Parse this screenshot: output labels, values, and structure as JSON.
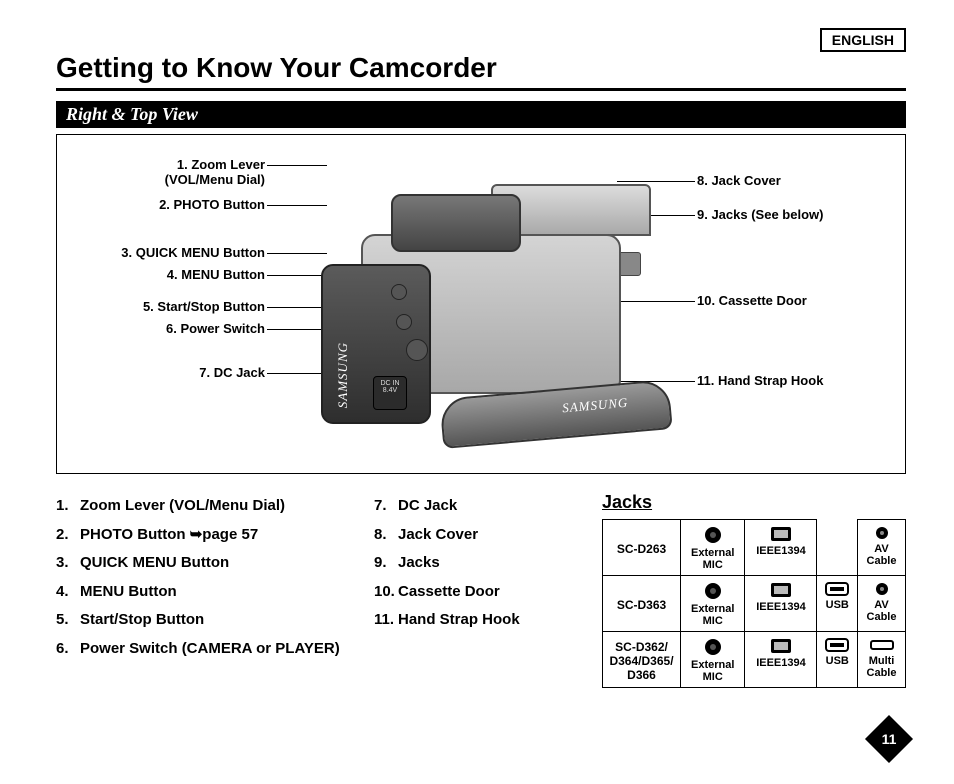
{
  "language_badge": "ENGLISH",
  "title": "Getting to Know Your Camcorder",
  "section": "Right & Top View",
  "brand": "SAMSUNG",
  "dc_label": "DC IN\n8.4V",
  "callouts_left": [
    {
      "n": "1",
      "label": "1. Zoom Lever",
      "sub": "(VOL/Menu Dial)"
    },
    {
      "n": "2",
      "label": "2. PHOTO Button"
    },
    {
      "n": "3",
      "label": "3. QUICK MENU Button"
    },
    {
      "n": "4",
      "label": "4. MENU Button"
    },
    {
      "n": "5",
      "label": "5. Start/Stop Button"
    },
    {
      "n": "6",
      "label": "6. Power Switch"
    },
    {
      "n": "7",
      "label": "7. DC Jack"
    }
  ],
  "callouts_right": [
    {
      "n": "8",
      "label": "8. Jack Cover"
    },
    {
      "n": "9",
      "label": "9. Jacks (See below)"
    },
    {
      "n": "10",
      "label": "10. Cassette Door"
    },
    {
      "n": "11",
      "label": "11. Hand Strap Hook"
    }
  ],
  "list_a": [
    "Zoom Lever (VOL/Menu Dial)",
    "PHOTO Button ➥page 57",
    "QUICK MENU Button",
    "MENU Button",
    "Start/Stop Button",
    "Power Switch (CAMERA or PLAYER)"
  ],
  "list_b": [
    "DC Jack",
    "Jack Cover",
    "Jacks",
    "Cassette Door",
    "Hand Strap Hook"
  ],
  "jacks_heading": "Jacks",
  "jack_types": {
    "ext_mic": "External MIC",
    "ieee": "IEEE1394",
    "usb": "USB",
    "av": "AV Cable",
    "multi": "Multi Cable"
  },
  "jack_models": [
    {
      "model": "SC-D263",
      "ports": [
        "ext_mic",
        "ieee",
        "",
        "av"
      ]
    },
    {
      "model": "SC-D363",
      "ports": [
        "ext_mic",
        "ieee",
        "usb",
        "av"
      ]
    },
    {
      "model": "SC-D362/D364/D365/D366",
      "ports": [
        "ext_mic",
        "ieee",
        "usb",
        "multi"
      ]
    }
  ],
  "page_number": "11"
}
